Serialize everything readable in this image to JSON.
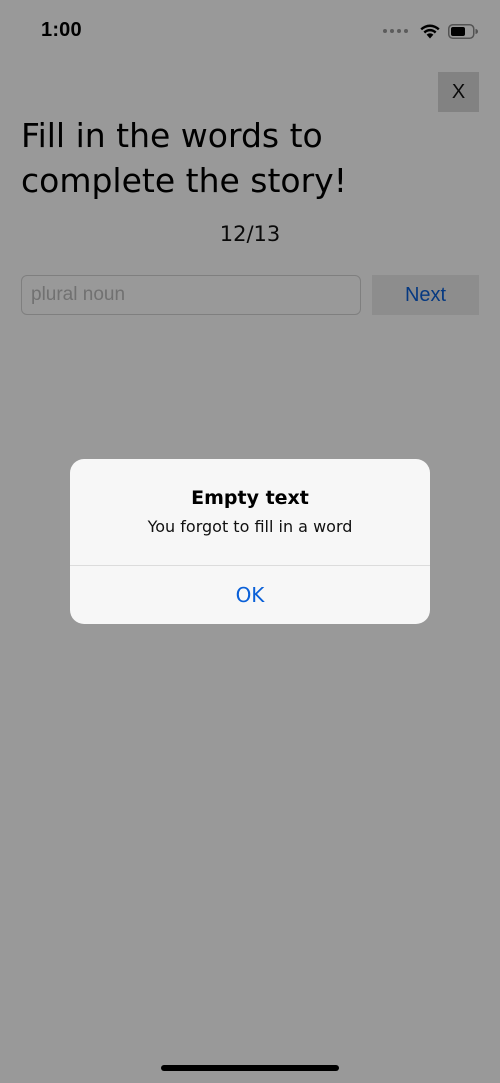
{
  "status_bar": {
    "time": "1:00",
    "icons": [
      "cellular-dots-icon",
      "wifi-icon",
      "battery-icon"
    ]
  },
  "screen": {
    "close_label": "X",
    "title": "Fill in the words to complete the story!",
    "progress": "12/13",
    "input": {
      "value": "",
      "placeholder": "plural noun"
    },
    "next_label": "Next"
  },
  "alert": {
    "title": "Empty text",
    "message": "You forgot to fill in a word",
    "ok_label": "OK"
  },
  "colors": {
    "accent": "#0a60d8",
    "overlay": "rgba(0,0,0,0.4)",
    "alert_background": "#f7f7f7"
  }
}
